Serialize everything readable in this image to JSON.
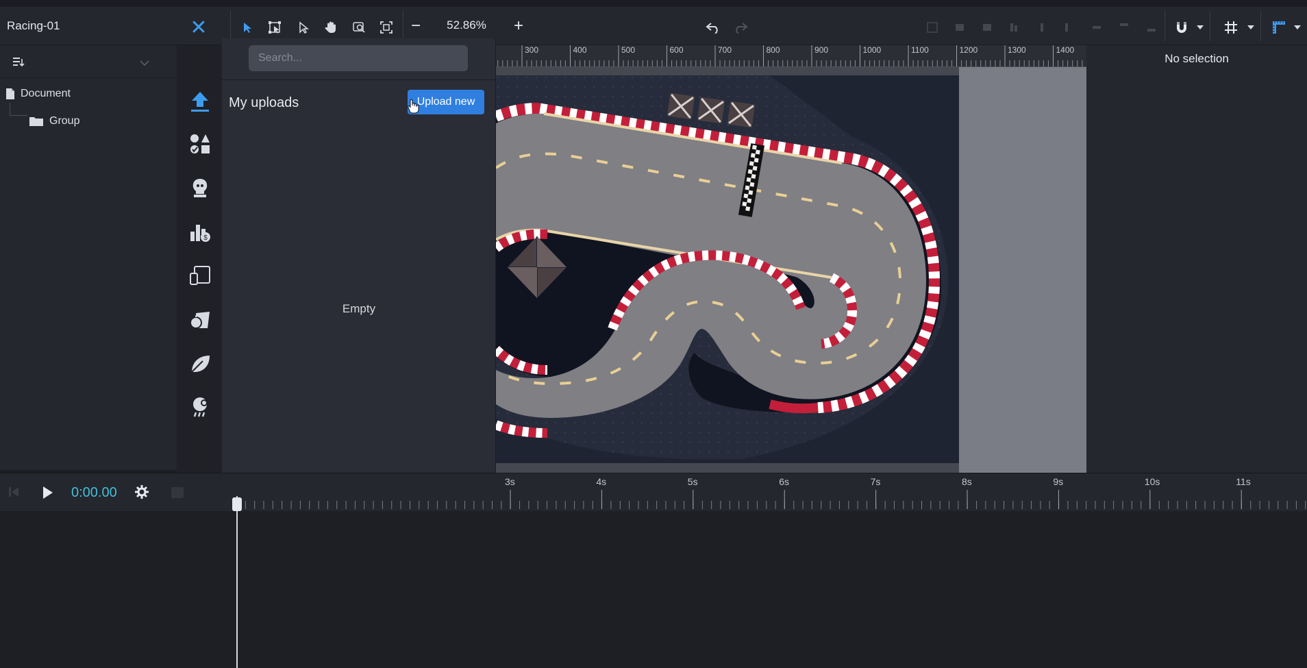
{
  "app": {
    "document_title": "Racing-01"
  },
  "toolbar": {
    "zoom": "52.86%",
    "tools": [
      "select-icon",
      "transform-icon",
      "direct-select-icon",
      "hand-icon",
      "zoom-area-icon",
      "fit-screen-icon"
    ],
    "accent": "#3d9bf0"
  },
  "layers": {
    "items": [
      {
        "label": "Document",
        "icon": "file-icon"
      },
      {
        "label": "Group",
        "icon": "folder-icon"
      }
    ]
  },
  "uploads": {
    "search_placeholder": "Search...",
    "title": "My uploads",
    "upload_button": "Upload new",
    "empty_text": "Empty",
    "button_color": "#2f7fe0"
  },
  "rail": {
    "items": [
      "upload-icon",
      "shapes-icon",
      "character-icon",
      "finance-icon",
      "devices-icon",
      "food-icon",
      "nature-icon",
      "weather-icon"
    ]
  },
  "ruler": {
    "labels": [
      "300",
      "400",
      "500",
      "600",
      "700",
      "800",
      "900",
      "1000",
      "1100",
      "1200",
      "1300",
      "1400"
    ]
  },
  "properties": {
    "empty_label": "No selection"
  },
  "timeline": {
    "current_time": "0:00.00",
    "labels": [
      "3s",
      "4s",
      "5s",
      "6s",
      "7s",
      "8s",
      "9s",
      "10s",
      "11s"
    ]
  }
}
